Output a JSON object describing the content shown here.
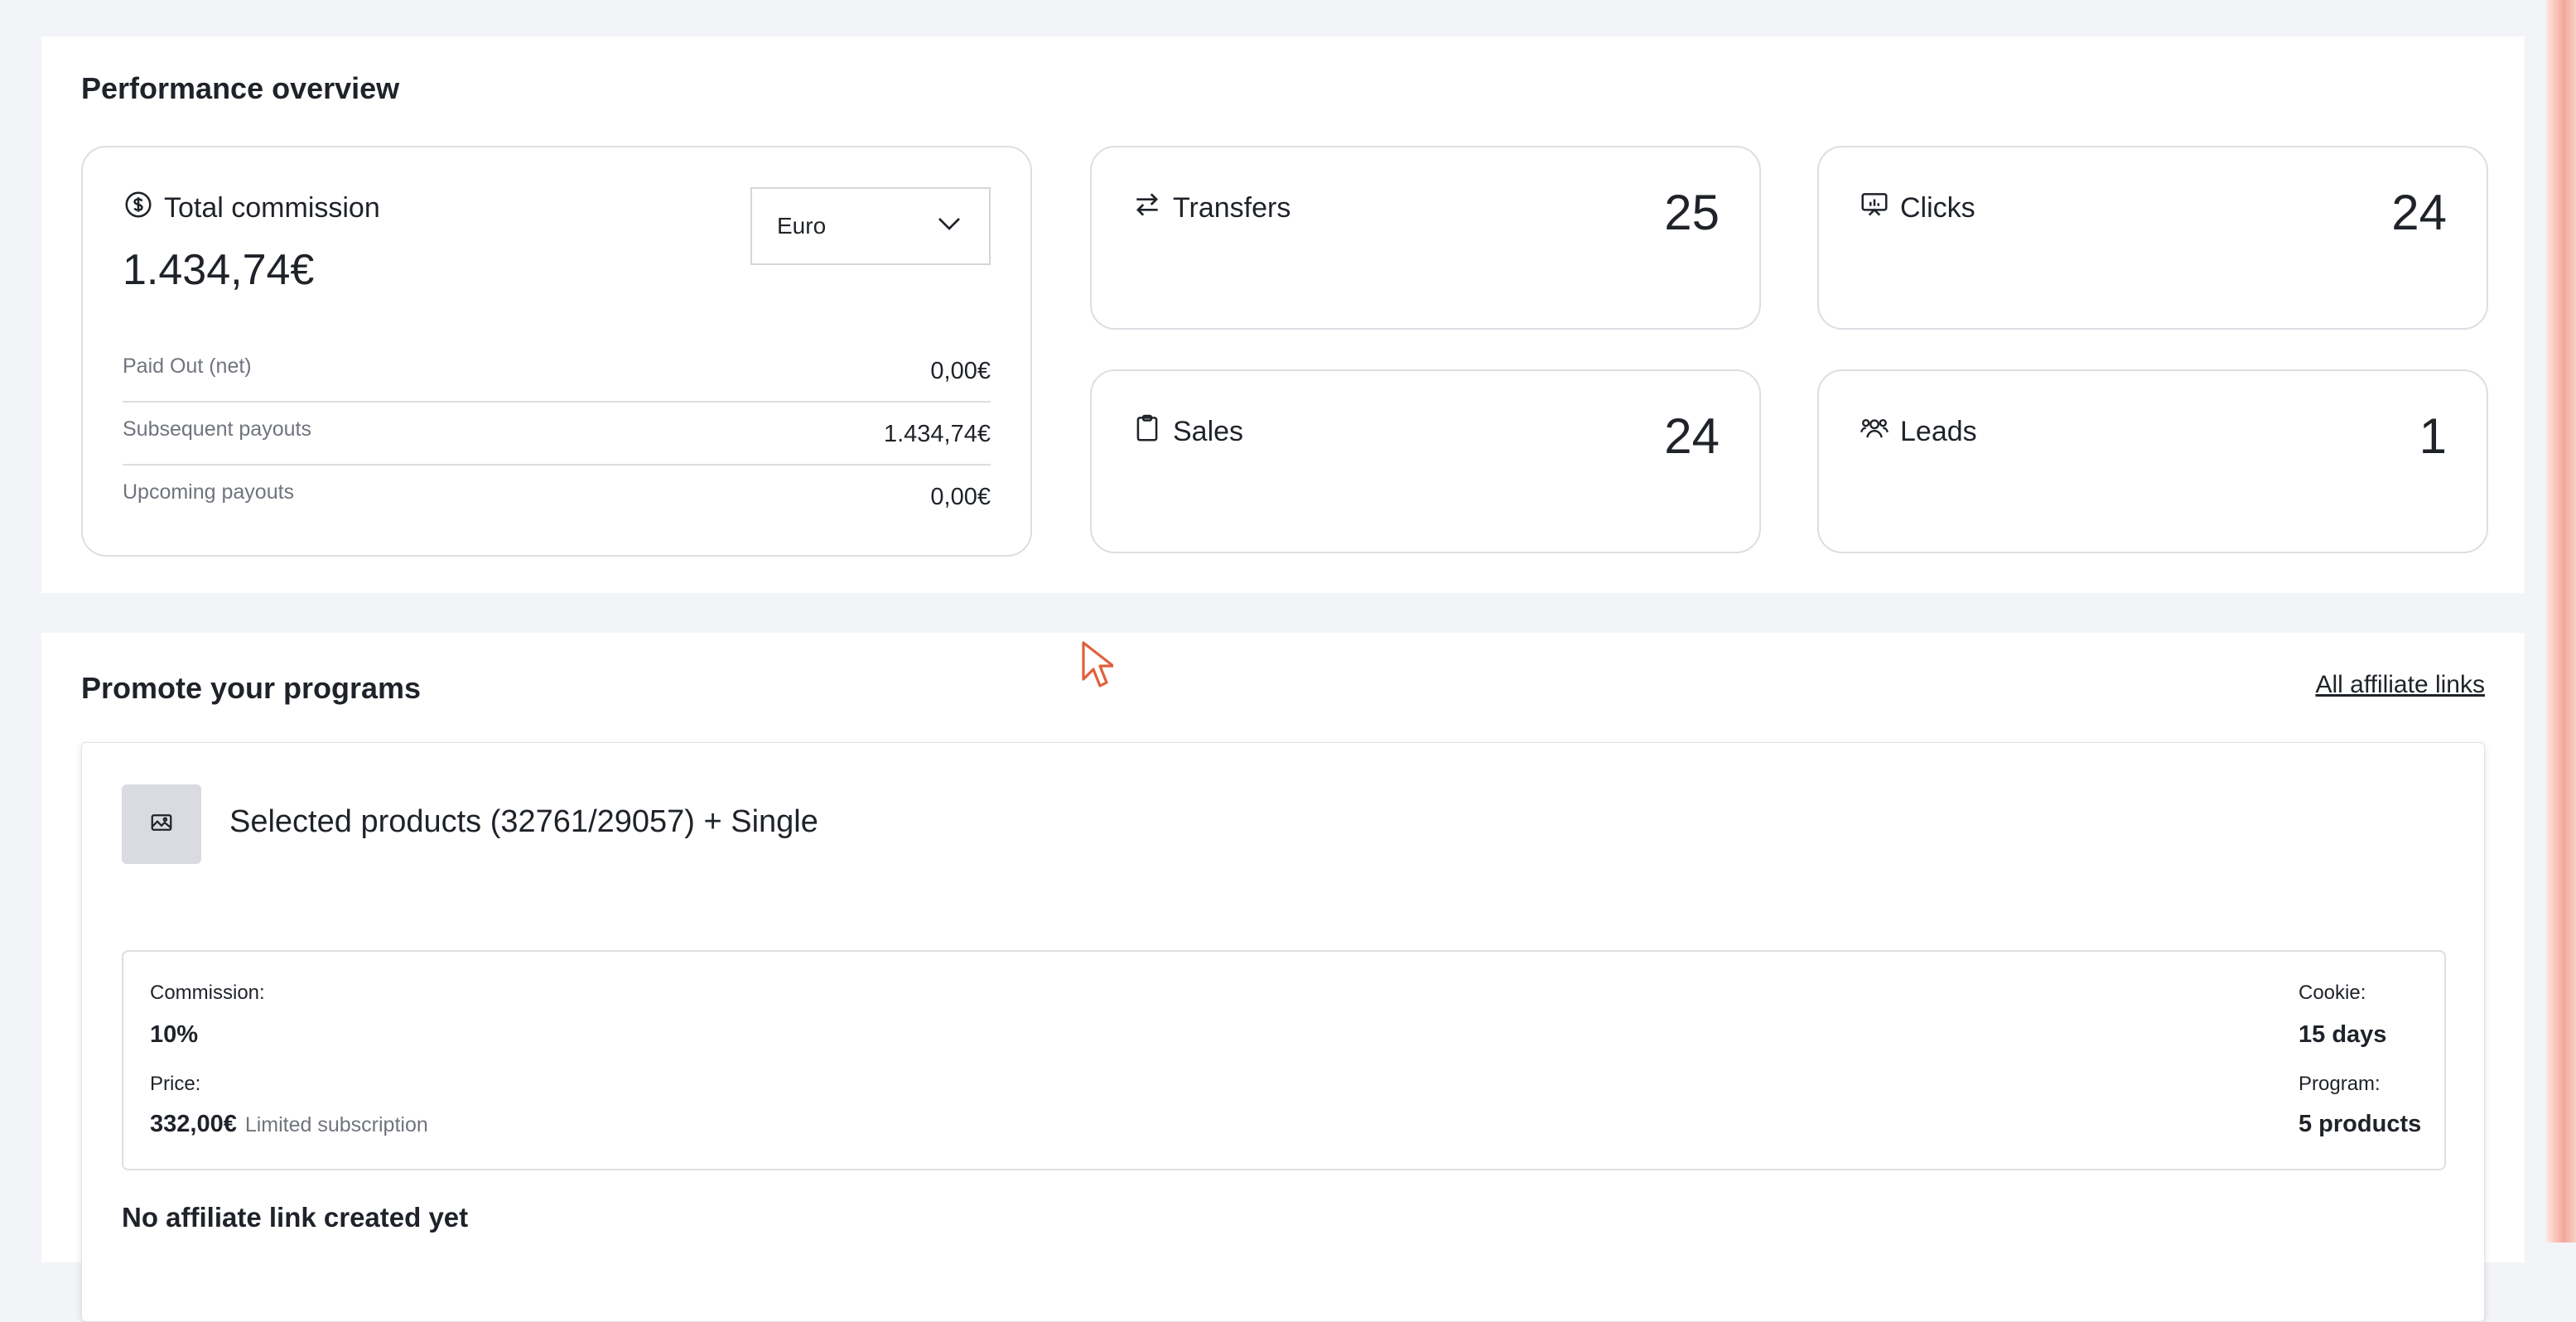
{
  "performance": {
    "title": "Performance overview",
    "commission": {
      "label": "Total commission",
      "amount": "1.434,74€",
      "currency_selected": "Euro",
      "rows": [
        {
          "label": "Paid Out (net)",
          "value": "0,00€"
        },
        {
          "label": "Subsequent payouts",
          "value": "1.434,74€"
        },
        {
          "label": "Upcoming payouts",
          "value": "0,00€"
        }
      ]
    },
    "metrics": {
      "transfers": {
        "label": "Transfers",
        "value": "25"
      },
      "clicks": {
        "label": "Clicks",
        "value": "24"
      },
      "sales": {
        "label": "Sales",
        "value": "24"
      },
      "leads": {
        "label": "Leads",
        "value": "1"
      }
    }
  },
  "promote": {
    "title": "Promote your programs",
    "all_links": "All affiliate links",
    "program": {
      "name": "Selected products (32761/29057) + Single",
      "commission_label": "Commission:",
      "commission_value": "10%",
      "price_label": "Price:",
      "price_value": "332,00€",
      "price_note": "Limited subscription",
      "cookie_label": "Cookie:",
      "cookie_value": "15 days",
      "program_label": "Program:",
      "program_value": "5 products",
      "no_link": "No affiliate link created yet"
    }
  },
  "colors": {
    "accent_edge": "#f3a898",
    "border": "#dcdee3",
    "text": "#1f2329",
    "muted": "#70747c"
  }
}
